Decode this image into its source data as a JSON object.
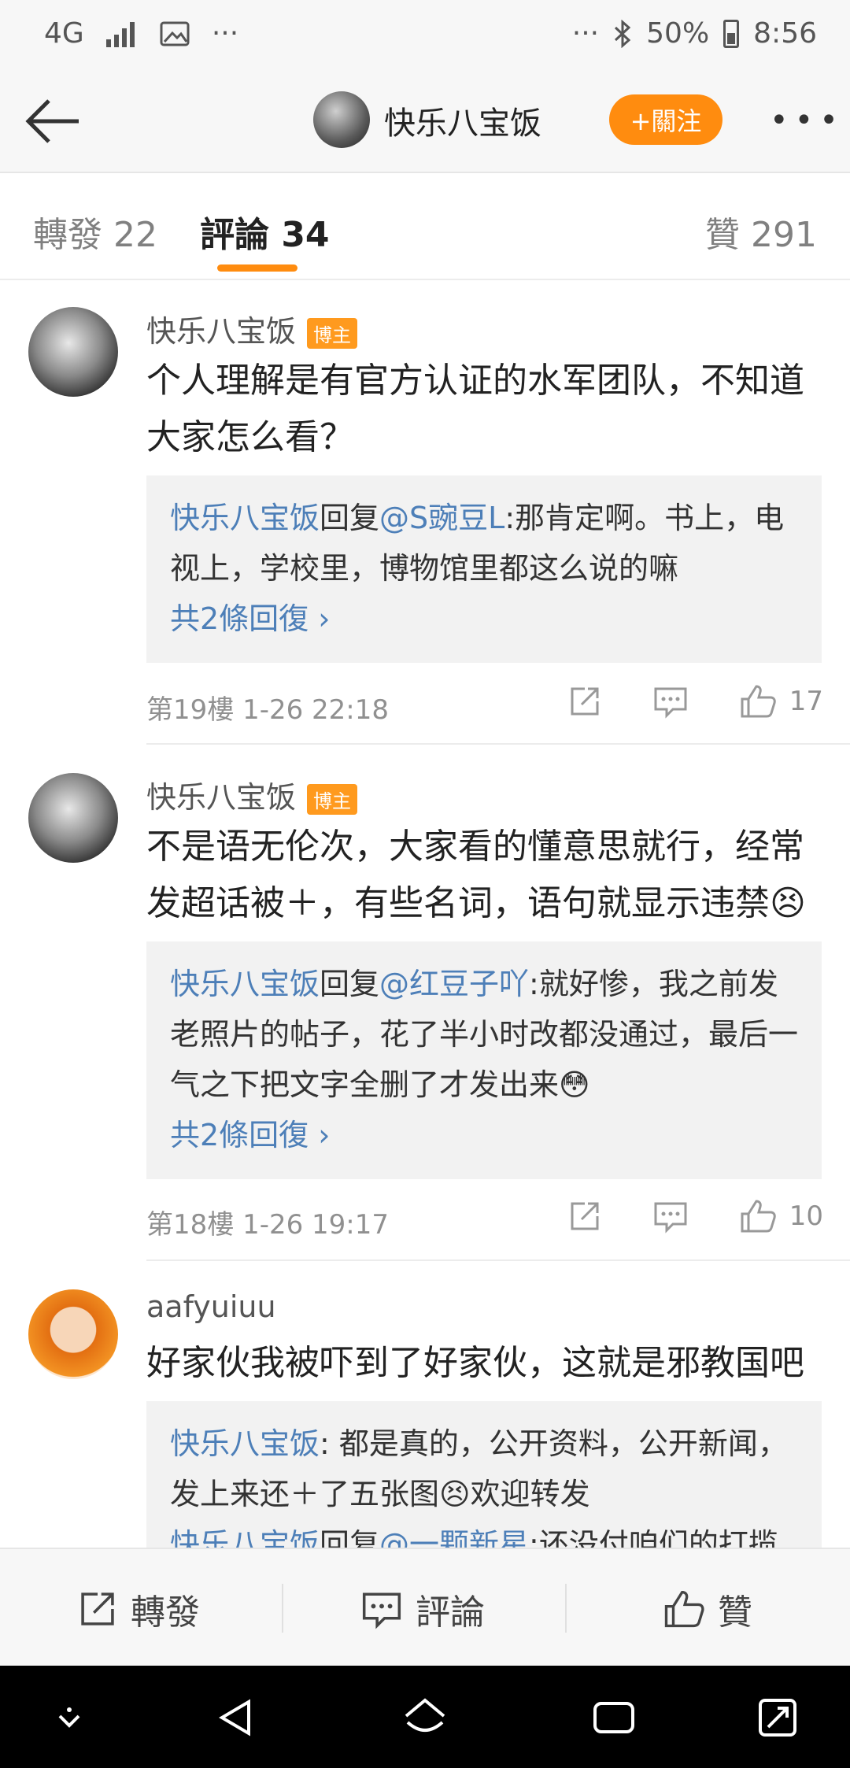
{
  "status_bar": {
    "network": "4G",
    "dots_left": "···",
    "dots_right": "···",
    "battery_percent": "50%",
    "time": "8:56"
  },
  "header": {
    "title": "快乐八宝饭",
    "follow_label": "+關注",
    "more_label": "•••"
  },
  "tabs": {
    "repost": "轉發 22",
    "comments": "評論 34",
    "likes": "贊 291"
  },
  "comments": [
    {
      "user": "快乐八宝饭",
      "badge": "博主",
      "text": "个人理解是有官方认证的水军团队，不知道大家怎么看？",
      "reply_author": "快乐八宝饭",
      "reply_verb": "回复",
      "reply_target": "@S豌豆L",
      "reply_text": ":那肯定啊。书上，电视上，学校里，博物馆里都这么说的嘛",
      "more_replies": "共2條回復 ›",
      "floor_time": "第19樓  1-26 22:18",
      "likes": "17"
    },
    {
      "user": "快乐八宝饭",
      "badge": "博主",
      "text": "不是语无伦次，大家看的懂意思就行，经常发超话被＋，有些名词，语句就显示违禁😣",
      "reply_author": "快乐八宝饭",
      "reply_verb": "回复",
      "reply_target": "@红豆子吖",
      "reply_text": ":就好惨，我之前发老照片的帖子，花了半小时改都没通过，最后一气之下把文字全删了才发出来😳",
      "more_replies": "共2條回復 ›",
      "floor_time": "第18樓  1-26 19:17",
      "likes": "10"
    },
    {
      "user": "aafyuiuu",
      "text": "好家伙我被吓到了好家伙，这就是邪教国吧",
      "reply_author": "快乐八宝饭",
      "reply_text": ": 都是真的，公开资料，公开新闻，发上来还＋了五张图😣欢迎转发",
      "reply2_author": "快乐八宝饭",
      "reply2_verb": "回复",
      "reply2_target": "@一颗新星",
      "reply2_text": ":还没付咱们的打揽"
    }
  ],
  "bottom_bar": {
    "repost": "轉發",
    "comment": "評論",
    "like": "贊"
  },
  "colors": {
    "accent": "#ff8c0f",
    "link": "#4d7fb8",
    "reply_bg": "#f2f2f2"
  }
}
